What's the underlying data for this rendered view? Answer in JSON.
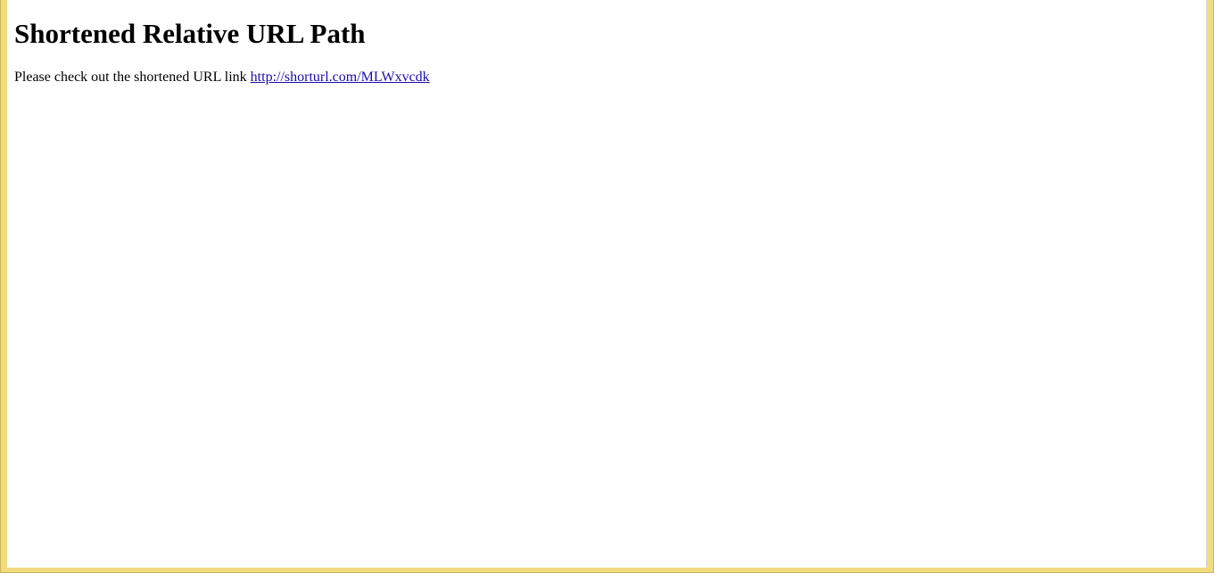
{
  "page": {
    "heading": "Shortened Relative URL Path",
    "message_prefix": "Please check out the shortened URL link ",
    "link_text": "http://shorturl.com/MLWxvcdk",
    "link_href": "http://shorturl.com/MLWxvcdk"
  },
  "colors": {
    "frame": "#f0dc7e",
    "link": "#1a0dab"
  }
}
